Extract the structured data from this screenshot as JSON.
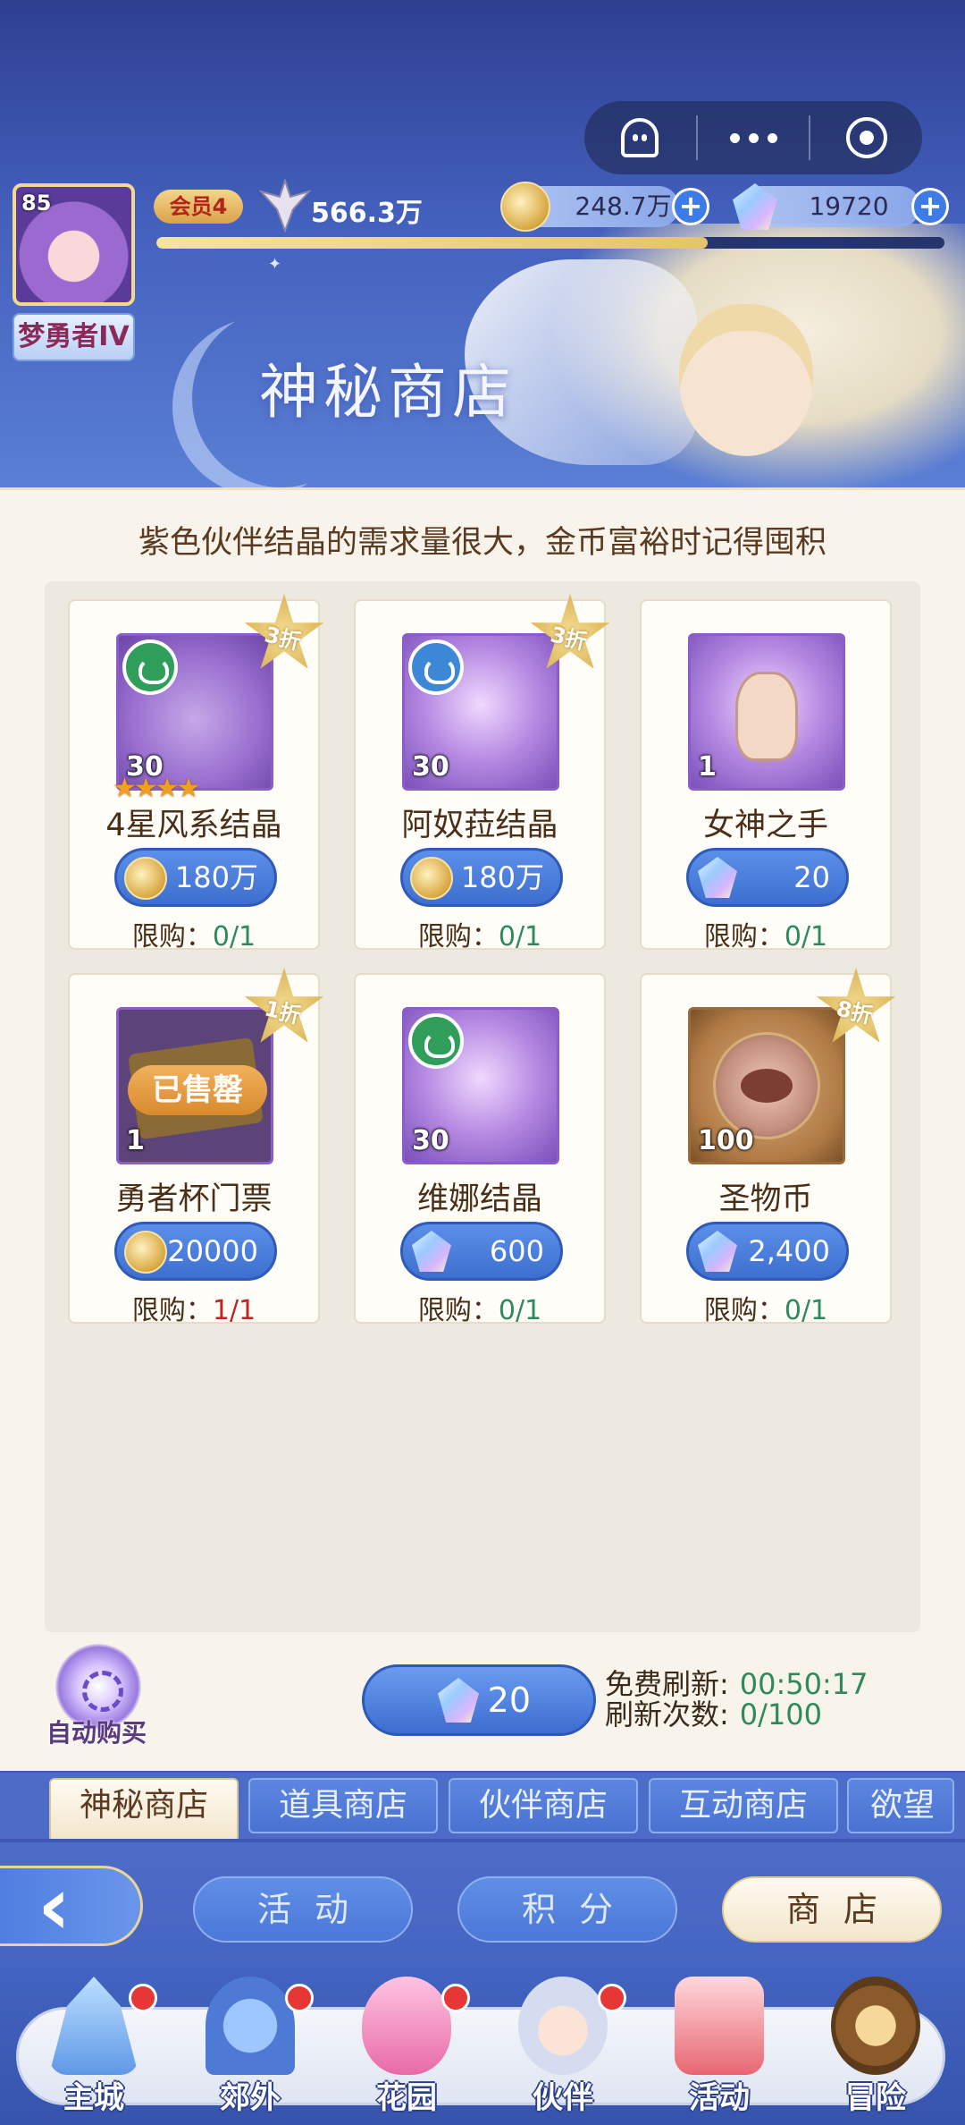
{
  "capsule": {
    "icons": [
      "ghost-icon",
      "more-dots-icon",
      "record-icon"
    ]
  },
  "player": {
    "level": "85",
    "name": "梦勇者IV",
    "vip": "会员4",
    "power": "566.3万",
    "exp_fraction": 0.7
  },
  "currencies": {
    "gold": "248.7万",
    "gem": "19720"
  },
  "shop": {
    "title": "神秘商店",
    "notice": "紫色伙伴结晶的需求量很大，金币富裕时记得囤积",
    "items": [
      {
        "name": "4星风系结晶",
        "qty": "30",
        "discount": "3折",
        "price": "180万",
        "currency": "gold",
        "limit_label": "限购：",
        "limit": "0/1",
        "stars": 4,
        "element": "wind"
      },
      {
        "name": "阿奴菈结晶",
        "qty": "30",
        "discount": "3折",
        "price": "180万",
        "currency": "gold",
        "limit_label": "限购：",
        "limit": "0/1",
        "element": "water"
      },
      {
        "name": "女神之手",
        "qty": "1",
        "discount": "",
        "price": "20",
        "currency": "gem",
        "limit_label": "限购：",
        "limit": "0/1"
      },
      {
        "name": "勇者杯门票",
        "qty": "1",
        "discount": "1折",
        "price": "20000",
        "currency": "gold",
        "limit_label": "限购：",
        "limit": "1/1",
        "sold_out": "已售罄"
      },
      {
        "name": "维娜结晶",
        "qty": "30",
        "discount": "",
        "price": "600",
        "currency": "gem",
        "limit_label": "限购：",
        "limit": "0/1",
        "element": "wind"
      },
      {
        "name": "圣物币",
        "qty": "100",
        "discount": "8折",
        "price": "2,400",
        "currency": "gem",
        "limit_label": "限购：",
        "limit": "0/1"
      }
    ],
    "auto_buy": "自动购买",
    "refresh_cost": "20",
    "free_refresh_label": "免费刷新:",
    "free_refresh_time": "00:50:17",
    "refresh_count_label": "刷新次数:",
    "refresh_count": "0/100"
  },
  "shop_tabs": [
    "神秘商店",
    "道具商店",
    "伙伴商店",
    "互动商店",
    "欲望"
  ],
  "category_tabs": [
    "活动",
    "积分",
    "商店"
  ],
  "main_nav": [
    {
      "label": "主城",
      "dot": true,
      "icon": "castle-icon"
    },
    {
      "label": "郊外",
      "dot": true,
      "icon": "portal-icon"
    },
    {
      "label": "花园",
      "dot": true,
      "icon": "heart-icon"
    },
    {
      "label": "伙伴",
      "dot": true,
      "icon": "partner-icon"
    },
    {
      "label": "活动",
      "dot": false,
      "icon": "gift-icon"
    },
    {
      "label": "冒险",
      "dot": false,
      "icon": "compass-icon"
    }
  ],
  "colors": {
    "accent": "#3e6fcf",
    "limit_ok": "#2e8a5a",
    "limit_full": "#c02424",
    "panel": "#f8f4ec"
  }
}
